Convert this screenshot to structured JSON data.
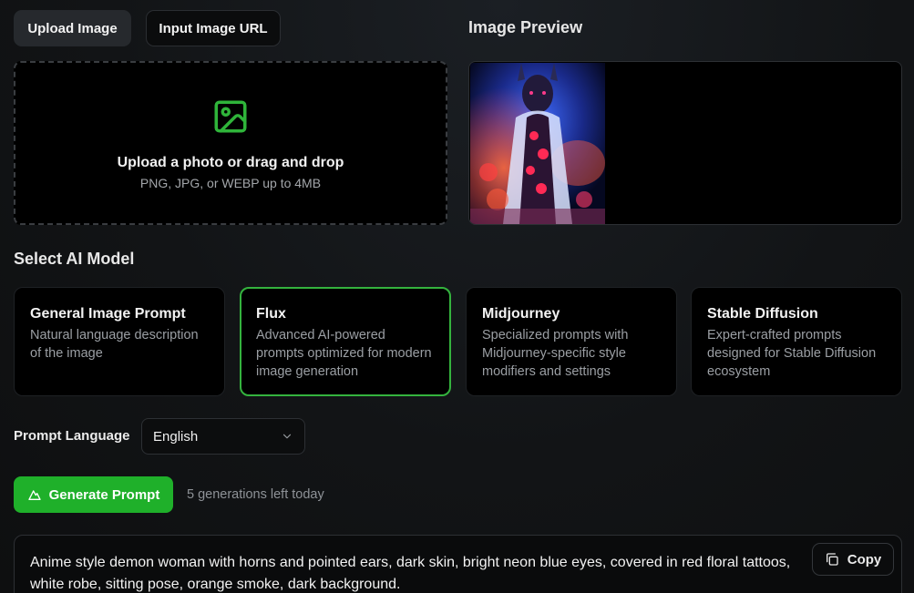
{
  "tabs": {
    "upload_label": "Upload Image",
    "url_label": "Input Image URL"
  },
  "upload": {
    "main_text": "Upload a photo or drag and drop",
    "sub_text": "PNG, JPG, or WEBP up to 4MB",
    "icon": "image-icon"
  },
  "preview": {
    "title": "Image Preview"
  },
  "models": {
    "title": "Select AI Model",
    "selected": "Flux",
    "items": [
      {
        "title": "General Image Prompt",
        "desc": "Natural language description of the image"
      },
      {
        "title": "Flux",
        "desc": "Advanced AI-powered prompts optimized for modern image generation"
      },
      {
        "title": "Midjourney",
        "desc": "Specialized prompts with Midjourney-specific style modifiers and settings"
      },
      {
        "title": "Stable Diffusion",
        "desc": "Expert-crafted prompts designed for Stable Diffusion ecosystem"
      }
    ]
  },
  "language": {
    "label": "Prompt Language",
    "value": "English"
  },
  "generate": {
    "label": "Generate Prompt",
    "count_text": "5 generations left today"
  },
  "result": {
    "text": "Anime style demon woman with horns and pointed ears, dark skin, bright neon blue eyes, covered in red floral tattoos, white robe, sitting pose, orange smoke, dark background.",
    "copy_label": "Copy"
  },
  "colors": {
    "accent": "#1fb02a",
    "selected_border": "#34b33e",
    "icon_green": "#2fb43a"
  }
}
